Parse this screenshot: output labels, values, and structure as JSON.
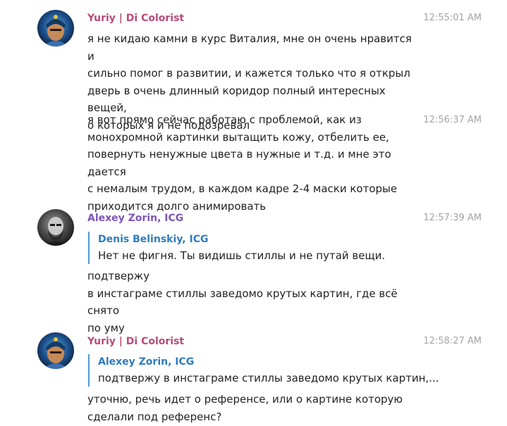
{
  "colors": {
    "sender_yuriy": "#b84a79",
    "sender_alexey": "#7e55b5",
    "reply_accent": "#4e9bd6",
    "reply_name": "#2f7cbc",
    "timestamp": "#a0a5aa",
    "text": "#222222"
  },
  "messages": [
    {
      "sender": "Yuriy | Di Colorist",
      "avatar": "avatar-yuriy",
      "items": [
        {
          "time": "12:55:01 AM",
          "text": "я не кидаю камни в курс Виталия, мне он очень нравится и\nсильно помог в развитии, и кажется только что я открыл\nдверь в очень длинный коридор полный интересных вещей,\nо которых я и не подозревал"
        },
        {
          "time": "12:56:37 AM",
          "text": "я вот прямо сейчас работаю с проблемой, как из\nмонохромной картинки вытащить кожу, отбелить ее,\nповернуть ненужные цвета в нужные и т.д. и мне это дается\nс немалым трудом, в каждом кадре 2-4 маски которые\nприходится долго анимировать"
        }
      ]
    },
    {
      "sender": "Alexey Zorin, ICG",
      "avatar": "avatar-alexey",
      "time": "12:57:39 AM",
      "reply": {
        "name": "Denis Belinskiy, ICG",
        "text": "Нет не фигня. Ты видишь стиллы и не путай вещи."
      },
      "text": "подтвержу\nв инстаграме стиллы заведомо крутых картин, где всё снято\nпо уму"
    },
    {
      "sender": "Yuriy | Di Colorist",
      "avatar": "avatar-yuriy",
      "time": "12:58:27 AM",
      "reply": {
        "name": "Alexey Zorin, ICG",
        "text": "подтвержу в инстаграме стиллы заведомо крутых картин,..."
      },
      "text": "уточню, речь идет о референсе, или о картине которую\nсделали под референс?"
    }
  ]
}
